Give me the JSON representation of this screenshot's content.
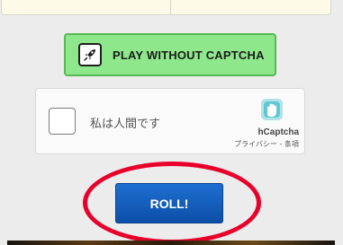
{
  "play_button": {
    "label": "PLAY WITHOUT CAPTCHA",
    "icon": "rocket-icon"
  },
  "captcha": {
    "checkbox_label": "私は人間です",
    "brand": "hCaptcha",
    "privacy_link": "プライバシー",
    "separator": " - ",
    "terms_link": "条項"
  },
  "roll_button": {
    "label": "ROLL!"
  },
  "colors": {
    "play_bg": "#8ee88b",
    "roll_bg": "#1e6fd0",
    "highlight_circle": "#e8002a",
    "hcaptcha_logo": "#2bb5c5"
  }
}
